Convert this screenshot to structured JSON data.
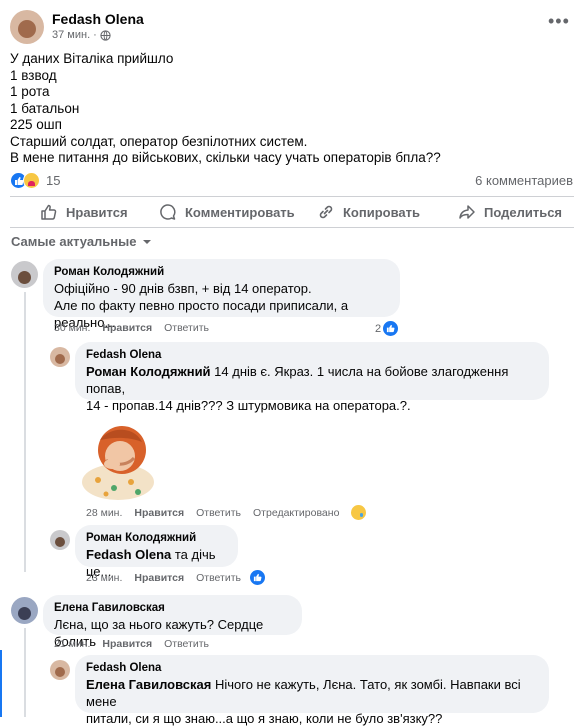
{
  "post": {
    "author": "Fedash Olena",
    "time": "37 мин. ·",
    "lines": [
      "У даних Віталіка прийшло",
      "1 взвод",
      "1 рота",
      "1 батальон",
      "225 ошп",
      "Старший солдат, оператор безпілотних систем.",
      "В мене питання до військових, скільки часу учать операторів бпла??"
    ],
    "reaction_count": "15",
    "comments_count": "6 комментариев",
    "more_icon": "ellipsis-icon",
    "colors": {
      "like": "#1877f2",
      "text": "#050505",
      "muted": "#65676b",
      "bubble": "#f0f2f5"
    }
  },
  "actions": {
    "like": "Нравится",
    "comment": "Комментировать",
    "copy": "Копировать",
    "share": "Поделиться"
  },
  "filter": {
    "label": "Самые актуальные"
  },
  "comments": [
    {
      "author": "Роман Колодяжний",
      "line1": "Офіційно - 90 днів бзвп, + від 14 оператор.",
      "line2": "Але по факту певно просто посади приписали, а реально...",
      "time": "30 мин.",
      "like": "Нравится",
      "reply": "Ответить",
      "reactions": "2"
    },
    {
      "author": "Fedash Olena",
      "mention": "Роман Колодяжний",
      "line1_rest": " 14 днів є. Якраз. 1 числа на бойове злагодження попав,",
      "line2": "14 - пропав.14 днів??? З штурмовика на оператора.?."
    },
    {
      "time": "28 мин.",
      "like": "Нравится",
      "reply": "Ответить",
      "edited": "Отредактировано"
    },
    {
      "author": "Роман Колодяжний",
      "mention": "Fedash Olena",
      "rest": " та дічь це...",
      "time": "23 мин.",
      "like": "Нравится",
      "reply": "Ответить"
    },
    {
      "author": "Елена Гавиловская",
      "text": "Лєна, що за нього кажуть? Сердце болить",
      "time": "21 мин.",
      "like": "Нравится",
      "reply": "Ответить"
    },
    {
      "author": "Fedash Olena",
      "mention": "Елена Гавиловская",
      "line1_rest": " Нічого не кажуть, Лєна. Тато, як зомбі. Навпаки всі мене",
      "line2": "питали, си я що знаю...а що я знаю, коли не було зв'язку??"
    }
  ]
}
